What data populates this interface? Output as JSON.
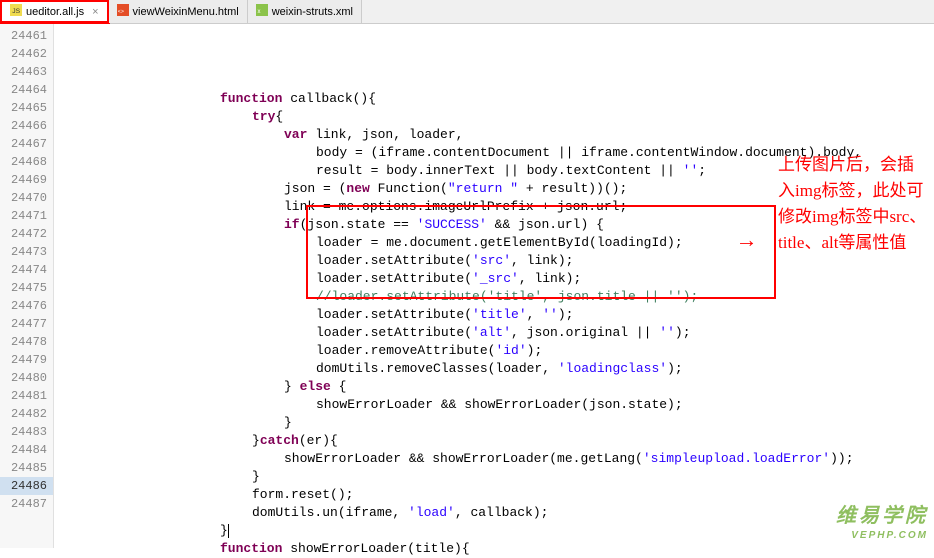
{
  "tabs": [
    {
      "label": "ueditor.all.js",
      "active": true,
      "close": "×",
      "icon": "js"
    },
    {
      "label": "viewWeixinMenu.html",
      "active": false,
      "close": "",
      "icon": "html"
    },
    {
      "label": "weixin-struts.xml",
      "active": false,
      "close": "",
      "icon": "xml"
    }
  ],
  "lines": {
    "start": 24461,
    "end": 24487,
    "highlight": 24486
  },
  "code": [
    {
      "n": 24461,
      "indent": 4,
      "seg": []
    },
    {
      "n": 24462,
      "indent": 5,
      "seg": [
        [
          "kw",
          "function"
        ],
        [
          "",
          " callback(){"
        ]
      ]
    },
    {
      "n": 24463,
      "indent": 6,
      "seg": [
        [
          "kw",
          "try"
        ],
        [
          "",
          "{"
        ]
      ]
    },
    {
      "n": 24464,
      "indent": 7,
      "seg": [
        [
          "kw",
          "var"
        ],
        [
          "",
          " link, json, loader,"
        ]
      ]
    },
    {
      "n": 24465,
      "indent": 8,
      "seg": [
        [
          "",
          "body = (iframe.contentDocument || iframe.contentWindow.document).body,"
        ]
      ]
    },
    {
      "n": 24466,
      "indent": 8,
      "seg": [
        [
          "",
          "result = body.innerText || body.textContent || "
        ],
        [
          "str",
          "''"
        ],
        [
          "",
          ";"
        ]
      ]
    },
    {
      "n": 24467,
      "indent": 7,
      "seg": [
        [
          "",
          "json = ("
        ],
        [
          "kw",
          "new"
        ],
        [
          "",
          " Function("
        ],
        [
          "str",
          "\"return \""
        ],
        [
          "",
          " + result))();"
        ]
      ]
    },
    {
      "n": 24468,
      "indent": 7,
      "seg": [
        [
          "",
          "link = me.options.imageUrlPrefix + json.url;"
        ]
      ]
    },
    {
      "n": 24469,
      "indent": 7,
      "seg": [
        [
          "kw",
          "if"
        ],
        [
          "",
          "(json.state == "
        ],
        [
          "str",
          "'SUCCESS'"
        ],
        [
          "",
          " && json.url) {"
        ]
      ]
    },
    {
      "n": 24470,
      "indent": 8,
      "seg": [
        [
          "",
          "loader = me.document.getElementById(loadingId);"
        ]
      ]
    },
    {
      "n": 24471,
      "indent": 8,
      "seg": [
        [
          "",
          "loader.setAttribute("
        ],
        [
          "str",
          "'src'"
        ],
        [
          "",
          ", link);"
        ]
      ]
    },
    {
      "n": 24472,
      "indent": 8,
      "seg": [
        [
          "",
          "loader.setAttribute("
        ],
        [
          "str",
          "'_src'"
        ],
        [
          "",
          ", link);"
        ]
      ]
    },
    {
      "n": 24473,
      "indent": 8,
      "seg": [
        [
          "com",
          "//loader.setAttribute('title', json.title || '');"
        ]
      ]
    },
    {
      "n": 24474,
      "indent": 8,
      "seg": [
        [
          "",
          "loader.setAttribute("
        ],
        [
          "str",
          "'title'"
        ],
        [
          "",
          ", "
        ],
        [
          "str",
          "''"
        ],
        [
          "",
          ");"
        ]
      ]
    },
    {
      "n": 24475,
      "indent": 8,
      "seg": [
        [
          "",
          "loader.setAttribute("
        ],
        [
          "str",
          "'alt'"
        ],
        [
          "",
          ", json.original || "
        ],
        [
          "str",
          "''"
        ],
        [
          "",
          ");"
        ]
      ]
    },
    {
      "n": 24476,
      "indent": 8,
      "seg": [
        [
          "",
          "loader.removeAttribute("
        ],
        [
          "str",
          "'id'"
        ],
        [
          "",
          ");"
        ]
      ]
    },
    {
      "n": 24477,
      "indent": 8,
      "seg": [
        [
          "",
          "domUtils.removeClasses(loader, "
        ],
        [
          "str",
          "'loadingclass'"
        ],
        [
          "",
          ");"
        ]
      ]
    },
    {
      "n": 24478,
      "indent": 7,
      "seg": [
        [
          "",
          "} "
        ],
        [
          "kw",
          "else"
        ],
        [
          "",
          " {"
        ]
      ]
    },
    {
      "n": 24479,
      "indent": 8,
      "seg": [
        [
          "",
          "showErrorLoader && showErrorLoader(json.state);"
        ]
      ]
    },
    {
      "n": 24480,
      "indent": 7,
      "seg": [
        [
          "",
          "}"
        ]
      ]
    },
    {
      "n": 24481,
      "indent": 6,
      "seg": [
        [
          "",
          "}"
        ],
        [
          "kw",
          "catch"
        ],
        [
          "",
          "(er){"
        ]
      ]
    },
    {
      "n": 24482,
      "indent": 7,
      "seg": [
        [
          "",
          "showErrorLoader && showErrorLoader(me.getLang("
        ],
        [
          "str",
          "'simpleupload.loadError'"
        ],
        [
          "",
          "));"
        ]
      ]
    },
    {
      "n": 24483,
      "indent": 6,
      "seg": [
        [
          "",
          "}"
        ]
      ]
    },
    {
      "n": 24484,
      "indent": 6,
      "seg": [
        [
          "",
          "form.reset();"
        ]
      ]
    },
    {
      "n": 24485,
      "indent": 6,
      "seg": [
        [
          "",
          "domUtils.un(iframe, "
        ],
        [
          "str",
          "'load'"
        ],
        [
          "",
          ", callback);"
        ]
      ]
    },
    {
      "n": 24486,
      "indent": 5,
      "seg": [
        [
          "",
          "}"
        ]
      ],
      "cursor": true
    },
    {
      "n": 24487,
      "indent": 5,
      "seg": [
        [
          "kw",
          "function"
        ],
        [
          "",
          " showErrorLoader(title){"
        ]
      ]
    }
  ],
  "annotation": "上传图片后，会插入img标签，此处可修改img标签中src、title、alt等属性值",
  "watermark": {
    "main": "维易学院",
    "sub": "VEPHP.COM"
  },
  "redbox_code": {
    "top_line": 24471,
    "bottom_line": 24475
  }
}
